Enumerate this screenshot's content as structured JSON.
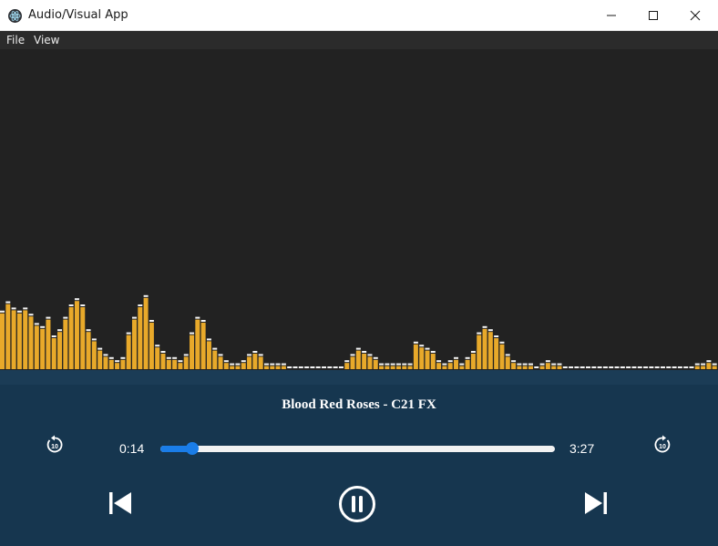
{
  "window": {
    "title": "Audio/Visual App",
    "icon": "electron-atom-icon"
  },
  "menu": {
    "file_label": "File",
    "view_label": "View"
  },
  "visualizer": {
    "bar_color": "#e8a92a",
    "cap_color": "#f5f5f5",
    "levels": [
      0.18,
      0.21,
      0.19,
      0.18,
      0.19,
      0.17,
      0.14,
      0.13,
      0.16,
      0.1,
      0.12,
      0.16,
      0.2,
      0.22,
      0.2,
      0.12,
      0.09,
      0.06,
      0.04,
      0.03,
      0.02,
      0.03,
      0.11,
      0.16,
      0.2,
      0.23,
      0.15,
      0.07,
      0.05,
      0.03,
      0.03,
      0.02,
      0.04,
      0.11,
      0.16,
      0.15,
      0.09,
      0.06,
      0.04,
      0.02,
      0.01,
      0.01,
      0.02,
      0.04,
      0.05,
      0.04,
      0.01,
      0.01,
      0.01,
      0.01,
      0.0,
      0.0,
      0.0,
      0.0,
      0.0,
      0.0,
      0.0,
      0.0,
      0.0,
      0.0,
      0.02,
      0.04,
      0.06,
      0.05,
      0.04,
      0.03,
      0.01,
      0.01,
      0.01,
      0.01,
      0.01,
      0.01,
      0.08,
      0.07,
      0.06,
      0.05,
      0.02,
      0.01,
      0.02,
      0.03,
      0.01,
      0.03,
      0.05,
      0.11,
      0.13,
      0.12,
      0.1,
      0.08,
      0.04,
      0.02,
      0.01,
      0.01,
      0.01,
      0.0,
      0.01,
      0.02,
      0.01,
      0.01,
      0.0,
      0.0,
      0.0,
      0.0,
      0.0,
      0.0,
      0.0,
      0.0,
      0.0,
      0.0,
      0.0,
      0.0,
      0.0,
      0.0,
      0.0,
      0.0,
      0.0,
      0.0,
      0.0,
      0.0,
      0.0,
      0.0,
      0.0,
      0.01,
      0.01,
      0.02,
      0.01
    ]
  },
  "player": {
    "track_title": "Blood Red Roses - C21 FX",
    "time_current": "0:14",
    "time_total": "3:27",
    "progress_fraction": 0.08,
    "rewind_label": "10",
    "forward_label": "10",
    "accent_color": "#1a7de8",
    "panel_color": "#16364f",
    "rewind_icon": "replay-10-icon",
    "forward_icon": "forward-10-icon",
    "prev_icon": "skip-previous-icon",
    "pause_icon": "pause-circle-icon",
    "next_icon": "skip-next-icon"
  }
}
